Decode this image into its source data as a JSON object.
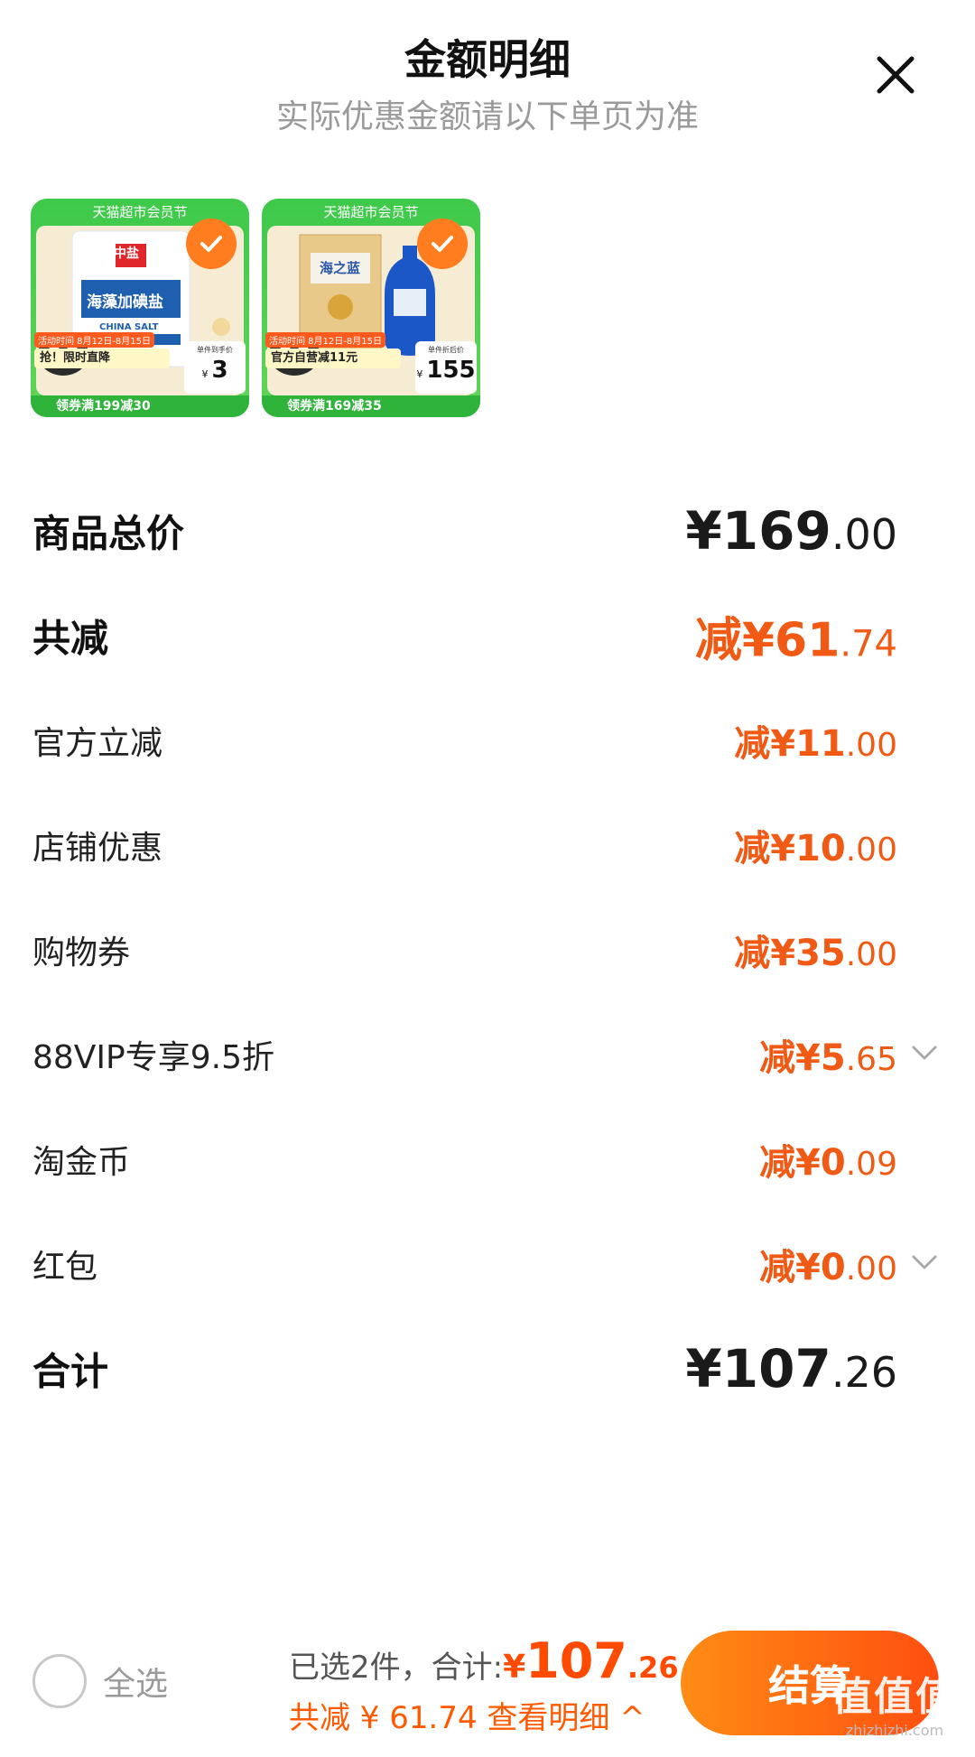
{
  "header": {
    "title": "金额明细",
    "subtitle": "实际优惠金额请以下单页为准"
  },
  "products": [
    {
      "banner": "天猫超市会员节",
      "brand": "中盐",
      "product_name": "海藻加碘盐",
      "product_en": "CHINA SALT",
      "promo_date": "活动时间 8月12日-8月15日",
      "promo_text": "抢！限时直降",
      "price_label": "单件到手价",
      "price_symbol": "¥",
      "price_value": "3",
      "coupon": "领券满199减30"
    },
    {
      "banner": "天猫超市会员节",
      "brand": "海之蓝",
      "product_name": "海之蓝",
      "promo_date": "活动时间 8月12日-8月15日",
      "promo_text": "官方自营减11元",
      "price_label": "单件折后价",
      "price_symbol": "¥",
      "price_value": "155",
      "coupon": "领券满169减35"
    }
  ],
  "rows": {
    "subtotal": {
      "label": "商品总价",
      "int": "¥169",
      "dec": ".00"
    },
    "total_discount": {
      "label": "共减",
      "int": "减¥61",
      "dec": ".74"
    },
    "official": {
      "label": "官方立减",
      "int": "减¥11",
      "dec": ".00"
    },
    "store": {
      "label": "店铺优惠",
      "int": "减¥10",
      "dec": ".00"
    },
    "coupon": {
      "label": "购物券",
      "int": "减¥35",
      "dec": ".00"
    },
    "vip": {
      "label": "88VIP专享9.5折",
      "int": "减¥5",
      "dec": ".65"
    },
    "gold": {
      "label": "淘金币",
      "int": "减¥0",
      "dec": ".09"
    },
    "redpacket": {
      "label": "红包",
      "int": "减¥0",
      "dec": ".00"
    },
    "total": {
      "label": "合计",
      "int": "¥107",
      "dec": ".26"
    }
  },
  "footer": {
    "select_all": "全选",
    "selected_text": "已选2件，合计:",
    "total_symbol": "¥",
    "total_int": "107",
    "total_dec": ".26",
    "discount_text": "共减 ¥ 61.74 查看明细 ^",
    "checkout": "结算",
    "watermark": "值值值",
    "watermark_url": "zhizhizhi.com"
  },
  "colors": {
    "accent_orange": "#f05a14",
    "checkout_gradient_start": "#ff8c14",
    "checkout_gradient_end": "#ff4e10",
    "product_green": "#3ec94a"
  }
}
